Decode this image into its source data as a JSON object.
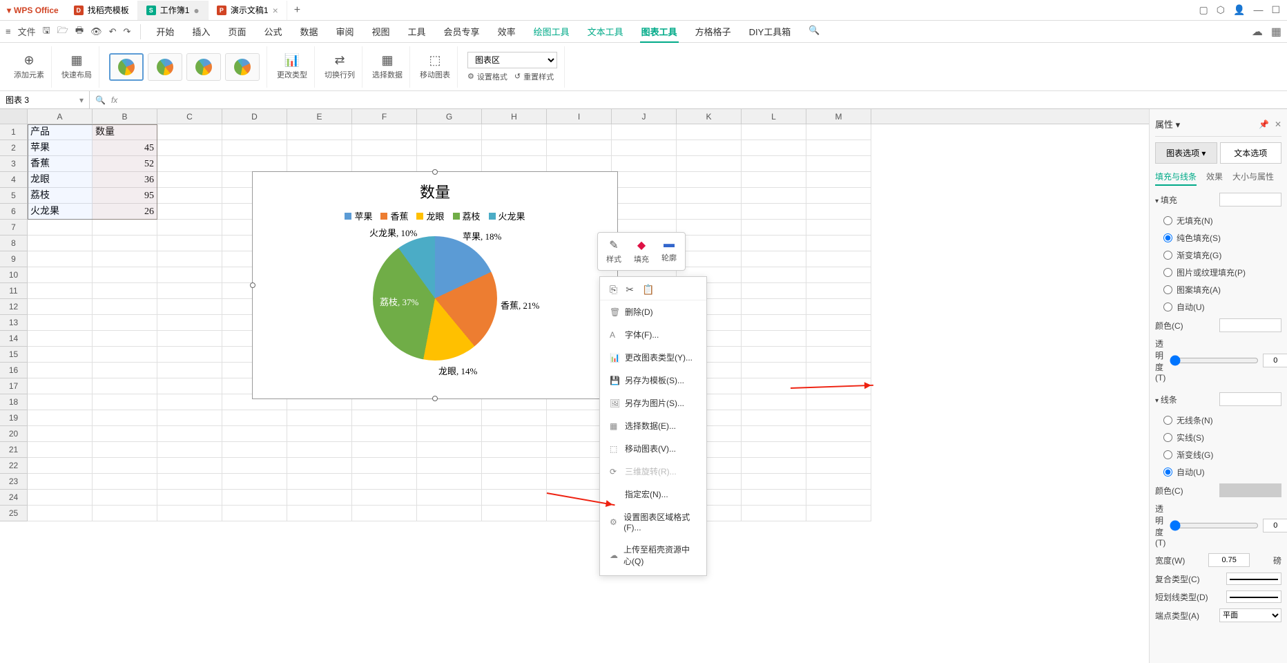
{
  "app_name": "WPS Office",
  "tabs": [
    {
      "icon": "d",
      "label": "找稻壳模板"
    },
    {
      "icon": "s",
      "label": "工作簿1",
      "active": true,
      "closable": true
    },
    {
      "icon": "p",
      "label": "演示文稿1",
      "closable": true
    }
  ],
  "menubar": {
    "file": "文件",
    "items": [
      "开始",
      "插入",
      "页面",
      "公式",
      "数据",
      "审阅",
      "视图",
      "工具",
      "会员专享",
      "效率",
      "绘图工具",
      "文本工具",
      "图表工具",
      "方格格子",
      "DIY工具箱"
    ],
    "active": "图表工具",
    "green": [
      "绘图工具",
      "文本工具",
      "图表工具"
    ]
  },
  "ribbon": {
    "add_element": "添加元素",
    "quick_layout": "快速布局",
    "change_type": "更改类型",
    "switch_rc": "切换行列",
    "select_data": "选择数据",
    "move_chart": "移动图表",
    "chart_area": "图表区",
    "set_format": "设置格式",
    "reset_style": "重置样式"
  },
  "name_box": "图表 3",
  "fx_symbol": "fx",
  "columns": [
    "A",
    "B",
    "C",
    "D",
    "E",
    "F",
    "G",
    "H",
    "I",
    "J",
    "K",
    "L",
    "M"
  ],
  "rows": 25,
  "table": {
    "header": [
      "产品",
      "数量"
    ],
    "data": [
      [
        "苹果",
        45
      ],
      [
        "香蕉",
        52
      ],
      [
        "龙眼",
        36
      ],
      [
        "荔枝",
        95
      ],
      [
        "火龙果",
        26
      ]
    ]
  },
  "chart_data": {
    "type": "pie",
    "title": "数量",
    "categories": [
      "苹果",
      "香蕉",
      "龙眼",
      "荔枝",
      "火龙果"
    ],
    "values": [
      45,
      52,
      36,
      95,
      26
    ],
    "percentages": [
      18,
      21,
      14,
      37,
      10
    ],
    "colors": [
      "#5b9bd5",
      "#ed7d31",
      "#ffc000",
      "#70ad47",
      "#4bacc6"
    ],
    "labels": [
      "苹果, 18%",
      "香蕉, 21%",
      "龙眼, 14%",
      "荔枝, 37%",
      "火龙果, 10%"
    ]
  },
  "float_toolbar": {
    "style": "样式",
    "fill": "填充",
    "outline": "轮廓"
  },
  "context_menu": {
    "delete": "删除(D)",
    "font": "字体(F)...",
    "change_type": "更改图表类型(Y)...",
    "save_template": "另存为模板(S)...",
    "save_image": "另存为图片(S)...",
    "select_data": "选择数据(E)...",
    "move_chart": "移动图表(V)...",
    "rotate_3d": "三维旋转(R)...",
    "assign_macro": "指定宏(N)...",
    "format_area": "设置图表区域格式(F)...",
    "upload": "上传至稻壳资源中心(Q)"
  },
  "right_panel": {
    "title": "属性",
    "tab_chart": "图表选项",
    "tab_text": "文本选项",
    "subtab_fill": "填充与线条",
    "subtab_effect": "效果",
    "subtab_size": "大小与属性",
    "sec_fill": "填充",
    "fill_none": "无填充(N)",
    "fill_solid": "纯色填充(S)",
    "fill_gradient": "渐变填充(G)",
    "fill_picture": "图片或纹理填充(P)",
    "fill_pattern": "图案填充(A)",
    "fill_auto": "自动(U)",
    "color": "颜色(C)",
    "transparency": "透明度(T)",
    "trans_val": "0",
    "trans_unit": "%",
    "sec_line": "线条",
    "line_none": "无线条(N)",
    "line_solid": "实线(S)",
    "line_gradient": "渐变线(G)",
    "line_auto": "自动(U)",
    "width": "宽度(W)",
    "width_val": "0.75",
    "width_unit": "磅",
    "compound": "复合类型(C)",
    "dash": "短划线类型(D)",
    "cap": "端点类型(A)",
    "cap_val": "平面"
  }
}
